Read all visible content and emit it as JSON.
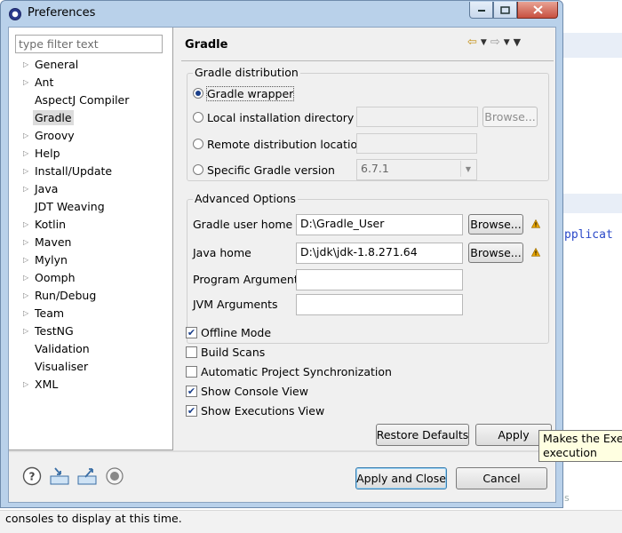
{
  "window": {
    "title": "Preferences"
  },
  "filter": {
    "placeholder": "type filter text"
  },
  "tree": [
    {
      "label": "General",
      "expandable": true
    },
    {
      "label": "Ant",
      "expandable": true
    },
    {
      "label": "AspectJ Compiler",
      "expandable": false
    },
    {
      "label": "Gradle",
      "expandable": false,
      "selected": true
    },
    {
      "label": "Groovy",
      "expandable": true
    },
    {
      "label": "Help",
      "expandable": true
    },
    {
      "label": "Install/Update",
      "expandable": true
    },
    {
      "label": "Java",
      "expandable": true
    },
    {
      "label": "JDT Weaving",
      "expandable": false
    },
    {
      "label": "Kotlin",
      "expandable": true
    },
    {
      "label": "Maven",
      "expandable": true
    },
    {
      "label": "Mylyn",
      "expandable": true
    },
    {
      "label": "Oomph",
      "expandable": true
    },
    {
      "label": "Run/Debug",
      "expandable": true
    },
    {
      "label": "Team",
      "expandable": true
    },
    {
      "label": "TestNG",
      "expandable": true
    },
    {
      "label": "Validation",
      "expandable": false
    },
    {
      "label": "Visualiser",
      "expandable": false
    },
    {
      "label": "XML",
      "expandable": true
    }
  ],
  "page": {
    "title": "Gradle"
  },
  "distribution": {
    "group_title": "Gradle distribution",
    "wrapper_label": "Gradle wrapper",
    "local_label": "Local installation directory",
    "remote_label": "Remote distribution location",
    "specific_label": "Specific Gradle version",
    "browse_label": "Browse...",
    "version_value": "6.7.1"
  },
  "advanced": {
    "group_title": "Advanced Options",
    "user_home_label": "Gradle user home",
    "user_home_value": "D:\\Gradle_User",
    "java_home_label": "Java home",
    "java_home_value": "D:\\jdk\\jdk-1.8.271.64",
    "program_args_label": "Program Arguments",
    "jvm_args_label": "JVM Arguments",
    "browse_label": "Browse..."
  },
  "options": [
    {
      "label": "Offline Mode",
      "checked": true
    },
    {
      "label": "Build Scans",
      "checked": false
    },
    {
      "label": "Automatic Project Synchronization",
      "checked": false
    },
    {
      "label": "Show Console View",
      "checked": true
    },
    {
      "label": "Show Executions View",
      "checked": true
    }
  ],
  "buttons": {
    "restore_defaults": "Restore Defaults",
    "apply": "Apply",
    "apply_and_close": "Apply and Close",
    "cancel": "Cancel"
  },
  "tooltip": {
    "line1": "Makes the Execu",
    "line2": "execution"
  },
  "background": {
    "code_text": "pplicat",
    "faint_text": "ns",
    "status_text": "consoles to display at this time."
  },
  "colors": {
    "title_bar": "#b9d1ea",
    "dialog_bg": "#f0f0f0",
    "tooltip_bg": "#ffffe1",
    "warning": "#e8a500"
  }
}
